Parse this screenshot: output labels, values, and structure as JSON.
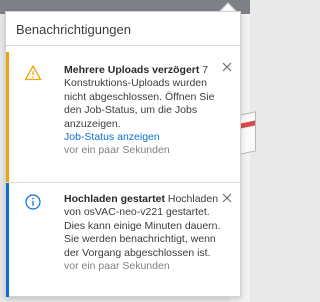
{
  "panel": {
    "title": "Benachrichtigungen"
  },
  "notifications": [
    {
      "type": "warning",
      "icon": "warning-icon",
      "accent_color": "#f0a30a",
      "title": "Mehrere Uploads verzögert",
      "message": " 7 Konstruktions-Uploads wurden nicht abgeschlossen. Öffnen Sie den Job-Status, um die Jobs anzuzeigen.",
      "link": "Job-Status anzeigen",
      "time": "vor ein paar Sekunden"
    },
    {
      "type": "info",
      "icon": "info-icon",
      "accent_color": "#0b6fd1",
      "title": "Hochladen gestartet",
      "message": " Hochladen von osVAC-neo-v221 gestartet. Dies kann einige Minuten dauern. Sie werden benachrichtigt, wenn der Vorgang abgeschlossen ist.",
      "time": "vor ein paar Sekunden"
    }
  ]
}
